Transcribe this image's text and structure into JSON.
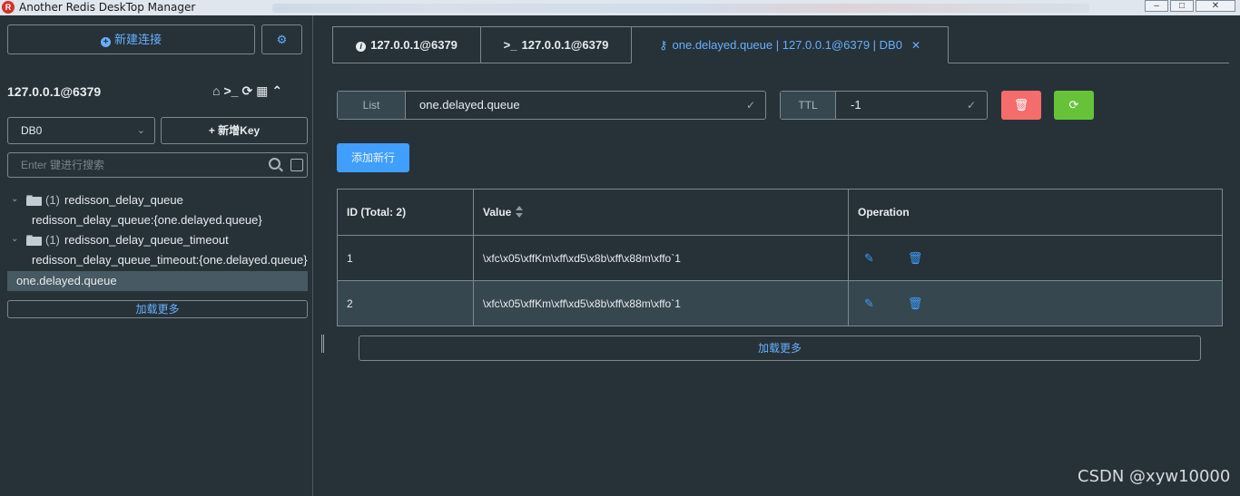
{
  "window": {
    "title": "Another Redis DeskTop Manager",
    "logo": "R"
  },
  "sidebar": {
    "new_connection_label": "新建连接",
    "connection_name": "127.0.0.1@6379",
    "db_select_value": "DB0",
    "new_key_label": "新增Key",
    "search_placeholder": "Enter 键进行搜索",
    "tree": [
      {
        "count": "(1)",
        "label": "redisson_delay_queue",
        "child": "redisson_delay_queue:{one.delayed.queue}"
      },
      {
        "count": "(1)",
        "label": "redisson_delay_queue_timeout",
        "child": "redisson_delay_queue_timeout:{one.delayed.queue}"
      }
    ],
    "selected_key": "one.delayed.queue",
    "load_more_label": "加载更多"
  },
  "tabs": [
    {
      "label": "127.0.0.1@6379",
      "icon": "info-icon"
    },
    {
      "label": "127.0.0.1@6379",
      "icon": "terminal-icon"
    },
    {
      "label": "one.delayed.queue | 127.0.0.1@6379 | DB0",
      "icon": "key-icon",
      "active": true
    }
  ],
  "key_bar": {
    "type_label": "List",
    "key_name": "one.delayed.queue",
    "ttl_label": "TTL",
    "ttl_value": "-1"
  },
  "add_row_label": "添加新行",
  "table": {
    "columns": [
      "ID (Total: 2)",
      "Value",
      "Operation"
    ],
    "rows": [
      {
        "id": "1",
        "value": "\\xfc\\x05\\xffKm\\xff\\xd5\\x8b\\xff\\x88m\\xffo`1"
      },
      {
        "id": "2",
        "value": "\\xfc\\x05\\xffKm\\xff\\xd5\\x8b\\xff\\x88m\\xffo`1"
      }
    ]
  },
  "main_load_more_label": "加载更多",
  "watermark": "CSDN @xyw10000",
  "colors": {
    "background": "#263238",
    "accent": "#409eff",
    "danger": "#f56c6c",
    "success": "#67c23a"
  }
}
